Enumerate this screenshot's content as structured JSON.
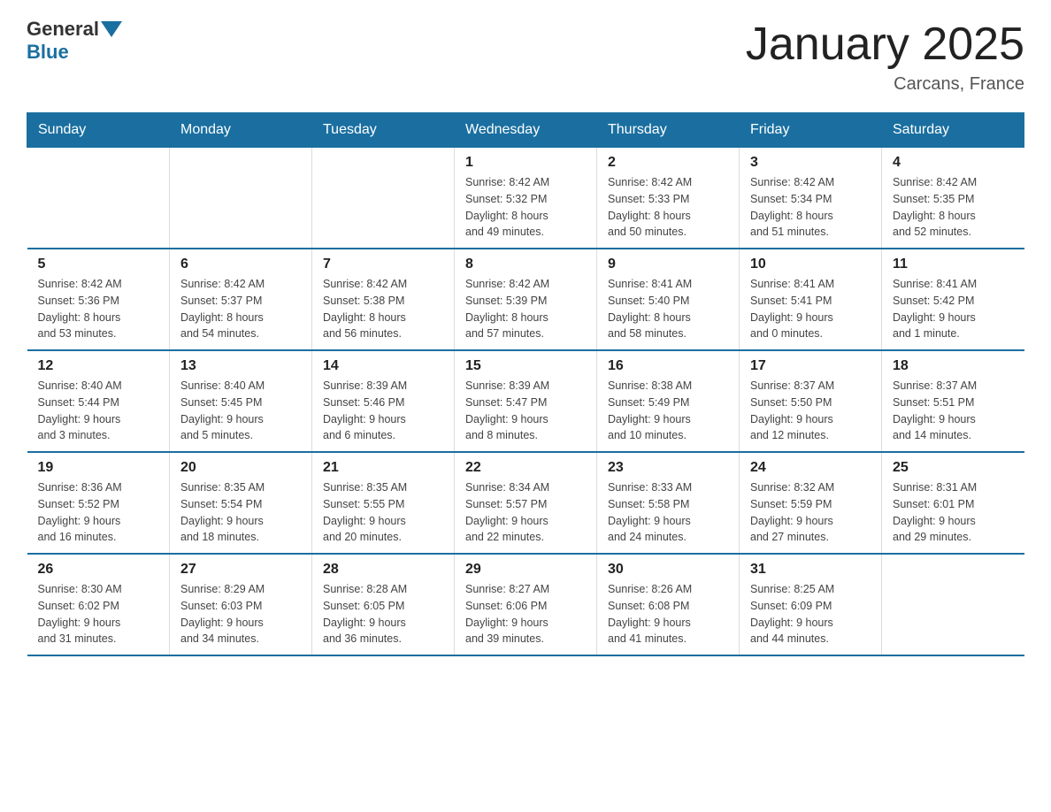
{
  "header": {
    "logo_general": "General",
    "logo_blue": "Blue",
    "title": "January 2025",
    "subtitle": "Carcans, France"
  },
  "calendar": {
    "days_of_week": [
      "Sunday",
      "Monday",
      "Tuesday",
      "Wednesday",
      "Thursday",
      "Friday",
      "Saturday"
    ],
    "weeks": [
      [
        {
          "day": "",
          "info": ""
        },
        {
          "day": "",
          "info": ""
        },
        {
          "day": "",
          "info": ""
        },
        {
          "day": "1",
          "info": "Sunrise: 8:42 AM\nSunset: 5:32 PM\nDaylight: 8 hours\nand 49 minutes."
        },
        {
          "day": "2",
          "info": "Sunrise: 8:42 AM\nSunset: 5:33 PM\nDaylight: 8 hours\nand 50 minutes."
        },
        {
          "day": "3",
          "info": "Sunrise: 8:42 AM\nSunset: 5:34 PM\nDaylight: 8 hours\nand 51 minutes."
        },
        {
          "day": "4",
          "info": "Sunrise: 8:42 AM\nSunset: 5:35 PM\nDaylight: 8 hours\nand 52 minutes."
        }
      ],
      [
        {
          "day": "5",
          "info": "Sunrise: 8:42 AM\nSunset: 5:36 PM\nDaylight: 8 hours\nand 53 minutes."
        },
        {
          "day": "6",
          "info": "Sunrise: 8:42 AM\nSunset: 5:37 PM\nDaylight: 8 hours\nand 54 minutes."
        },
        {
          "day": "7",
          "info": "Sunrise: 8:42 AM\nSunset: 5:38 PM\nDaylight: 8 hours\nand 56 minutes."
        },
        {
          "day": "8",
          "info": "Sunrise: 8:42 AM\nSunset: 5:39 PM\nDaylight: 8 hours\nand 57 minutes."
        },
        {
          "day": "9",
          "info": "Sunrise: 8:41 AM\nSunset: 5:40 PM\nDaylight: 8 hours\nand 58 minutes."
        },
        {
          "day": "10",
          "info": "Sunrise: 8:41 AM\nSunset: 5:41 PM\nDaylight: 9 hours\nand 0 minutes."
        },
        {
          "day": "11",
          "info": "Sunrise: 8:41 AM\nSunset: 5:42 PM\nDaylight: 9 hours\nand 1 minute."
        }
      ],
      [
        {
          "day": "12",
          "info": "Sunrise: 8:40 AM\nSunset: 5:44 PM\nDaylight: 9 hours\nand 3 minutes."
        },
        {
          "day": "13",
          "info": "Sunrise: 8:40 AM\nSunset: 5:45 PM\nDaylight: 9 hours\nand 5 minutes."
        },
        {
          "day": "14",
          "info": "Sunrise: 8:39 AM\nSunset: 5:46 PM\nDaylight: 9 hours\nand 6 minutes."
        },
        {
          "day": "15",
          "info": "Sunrise: 8:39 AM\nSunset: 5:47 PM\nDaylight: 9 hours\nand 8 minutes."
        },
        {
          "day": "16",
          "info": "Sunrise: 8:38 AM\nSunset: 5:49 PM\nDaylight: 9 hours\nand 10 minutes."
        },
        {
          "day": "17",
          "info": "Sunrise: 8:37 AM\nSunset: 5:50 PM\nDaylight: 9 hours\nand 12 minutes."
        },
        {
          "day": "18",
          "info": "Sunrise: 8:37 AM\nSunset: 5:51 PM\nDaylight: 9 hours\nand 14 minutes."
        }
      ],
      [
        {
          "day": "19",
          "info": "Sunrise: 8:36 AM\nSunset: 5:52 PM\nDaylight: 9 hours\nand 16 minutes."
        },
        {
          "day": "20",
          "info": "Sunrise: 8:35 AM\nSunset: 5:54 PM\nDaylight: 9 hours\nand 18 minutes."
        },
        {
          "day": "21",
          "info": "Sunrise: 8:35 AM\nSunset: 5:55 PM\nDaylight: 9 hours\nand 20 minutes."
        },
        {
          "day": "22",
          "info": "Sunrise: 8:34 AM\nSunset: 5:57 PM\nDaylight: 9 hours\nand 22 minutes."
        },
        {
          "day": "23",
          "info": "Sunrise: 8:33 AM\nSunset: 5:58 PM\nDaylight: 9 hours\nand 24 minutes."
        },
        {
          "day": "24",
          "info": "Sunrise: 8:32 AM\nSunset: 5:59 PM\nDaylight: 9 hours\nand 27 minutes."
        },
        {
          "day": "25",
          "info": "Sunrise: 8:31 AM\nSunset: 6:01 PM\nDaylight: 9 hours\nand 29 minutes."
        }
      ],
      [
        {
          "day": "26",
          "info": "Sunrise: 8:30 AM\nSunset: 6:02 PM\nDaylight: 9 hours\nand 31 minutes."
        },
        {
          "day": "27",
          "info": "Sunrise: 8:29 AM\nSunset: 6:03 PM\nDaylight: 9 hours\nand 34 minutes."
        },
        {
          "day": "28",
          "info": "Sunrise: 8:28 AM\nSunset: 6:05 PM\nDaylight: 9 hours\nand 36 minutes."
        },
        {
          "day": "29",
          "info": "Sunrise: 8:27 AM\nSunset: 6:06 PM\nDaylight: 9 hours\nand 39 minutes."
        },
        {
          "day": "30",
          "info": "Sunrise: 8:26 AM\nSunset: 6:08 PM\nDaylight: 9 hours\nand 41 minutes."
        },
        {
          "day": "31",
          "info": "Sunrise: 8:25 AM\nSunset: 6:09 PM\nDaylight: 9 hours\nand 44 minutes."
        },
        {
          "day": "",
          "info": ""
        }
      ]
    ]
  }
}
